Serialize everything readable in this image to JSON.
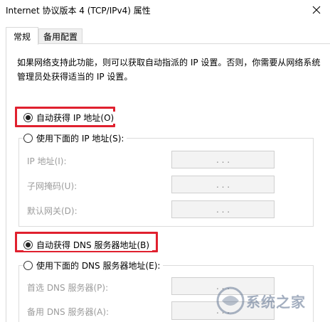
{
  "window": {
    "title": "Internet 协议版本 4 (TCP/IPv4) 属性"
  },
  "tabs": [
    {
      "label": "常规",
      "active": true
    },
    {
      "label": "备用配置",
      "active": false
    }
  ],
  "description": "如果网络支持此功能，则可以获取自动指派的 IP 设置。否则，你需要从网络系统管理员处获得适当的 IP 设置。",
  "ip_section": {
    "auto_label": "自动获得 IP 地址(O)",
    "auto_checked": true,
    "manual_label": "使用下面的 IP 地址(S):",
    "manual_checked": false,
    "fields": [
      {
        "label": "IP 地址(I):",
        "value": ".   .   ."
      },
      {
        "label": "子网掩码(U):",
        "value": ".   .   ."
      },
      {
        "label": "默认网关(D):",
        "value": ".   .   ."
      }
    ]
  },
  "dns_section": {
    "auto_label": "自动获得 DNS 服务器地址(B)",
    "auto_checked": true,
    "manual_label": "使用下面的 DNS 服务器地址(E):",
    "manual_checked": false,
    "fields": [
      {
        "label": "首选 DNS 服务器(P):",
        "value": ".   .   ."
      },
      {
        "label": "备用 DNS 服务器(A):",
        "value": ".   .   ."
      }
    ]
  },
  "highlight_color": "#e0202e",
  "icons": {
    "close": "close-icon",
    "radio_selected": "radio-selected-icon",
    "radio_unselected": "radio-unselected-icon"
  },
  "watermark": {
    "text": "系统之家"
  }
}
